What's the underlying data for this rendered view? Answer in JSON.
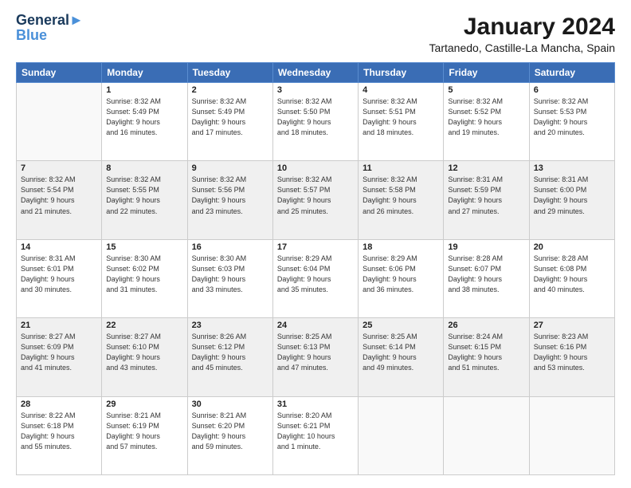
{
  "header": {
    "logo_line1": "General",
    "logo_line2": "Blue",
    "month": "January 2024",
    "location": "Tartanedo, Castille-La Mancha, Spain"
  },
  "weekdays": [
    "Sunday",
    "Monday",
    "Tuesday",
    "Wednesday",
    "Thursday",
    "Friday",
    "Saturday"
  ],
  "weeks": [
    [
      {
        "day": "",
        "info": ""
      },
      {
        "day": "1",
        "info": "Sunrise: 8:32 AM\nSunset: 5:49 PM\nDaylight: 9 hours\nand 16 minutes."
      },
      {
        "day": "2",
        "info": "Sunrise: 8:32 AM\nSunset: 5:49 PM\nDaylight: 9 hours\nand 17 minutes."
      },
      {
        "day": "3",
        "info": "Sunrise: 8:32 AM\nSunset: 5:50 PM\nDaylight: 9 hours\nand 18 minutes."
      },
      {
        "day": "4",
        "info": "Sunrise: 8:32 AM\nSunset: 5:51 PM\nDaylight: 9 hours\nand 18 minutes."
      },
      {
        "day": "5",
        "info": "Sunrise: 8:32 AM\nSunset: 5:52 PM\nDaylight: 9 hours\nand 19 minutes."
      },
      {
        "day": "6",
        "info": "Sunrise: 8:32 AM\nSunset: 5:53 PM\nDaylight: 9 hours\nand 20 minutes."
      }
    ],
    [
      {
        "day": "7",
        "info": "Sunrise: 8:32 AM\nSunset: 5:54 PM\nDaylight: 9 hours\nand 21 minutes."
      },
      {
        "day": "8",
        "info": "Sunrise: 8:32 AM\nSunset: 5:55 PM\nDaylight: 9 hours\nand 22 minutes."
      },
      {
        "day": "9",
        "info": "Sunrise: 8:32 AM\nSunset: 5:56 PM\nDaylight: 9 hours\nand 23 minutes."
      },
      {
        "day": "10",
        "info": "Sunrise: 8:32 AM\nSunset: 5:57 PM\nDaylight: 9 hours\nand 25 minutes."
      },
      {
        "day": "11",
        "info": "Sunrise: 8:32 AM\nSunset: 5:58 PM\nDaylight: 9 hours\nand 26 minutes."
      },
      {
        "day": "12",
        "info": "Sunrise: 8:31 AM\nSunset: 5:59 PM\nDaylight: 9 hours\nand 27 minutes."
      },
      {
        "day": "13",
        "info": "Sunrise: 8:31 AM\nSunset: 6:00 PM\nDaylight: 9 hours\nand 29 minutes."
      }
    ],
    [
      {
        "day": "14",
        "info": "Sunrise: 8:31 AM\nSunset: 6:01 PM\nDaylight: 9 hours\nand 30 minutes."
      },
      {
        "day": "15",
        "info": "Sunrise: 8:30 AM\nSunset: 6:02 PM\nDaylight: 9 hours\nand 31 minutes."
      },
      {
        "day": "16",
        "info": "Sunrise: 8:30 AM\nSunset: 6:03 PM\nDaylight: 9 hours\nand 33 minutes."
      },
      {
        "day": "17",
        "info": "Sunrise: 8:29 AM\nSunset: 6:04 PM\nDaylight: 9 hours\nand 35 minutes."
      },
      {
        "day": "18",
        "info": "Sunrise: 8:29 AM\nSunset: 6:06 PM\nDaylight: 9 hours\nand 36 minutes."
      },
      {
        "day": "19",
        "info": "Sunrise: 8:28 AM\nSunset: 6:07 PM\nDaylight: 9 hours\nand 38 minutes."
      },
      {
        "day": "20",
        "info": "Sunrise: 8:28 AM\nSunset: 6:08 PM\nDaylight: 9 hours\nand 40 minutes."
      }
    ],
    [
      {
        "day": "21",
        "info": "Sunrise: 8:27 AM\nSunset: 6:09 PM\nDaylight: 9 hours\nand 41 minutes."
      },
      {
        "day": "22",
        "info": "Sunrise: 8:27 AM\nSunset: 6:10 PM\nDaylight: 9 hours\nand 43 minutes."
      },
      {
        "day": "23",
        "info": "Sunrise: 8:26 AM\nSunset: 6:12 PM\nDaylight: 9 hours\nand 45 minutes."
      },
      {
        "day": "24",
        "info": "Sunrise: 8:25 AM\nSunset: 6:13 PM\nDaylight: 9 hours\nand 47 minutes."
      },
      {
        "day": "25",
        "info": "Sunrise: 8:25 AM\nSunset: 6:14 PM\nDaylight: 9 hours\nand 49 minutes."
      },
      {
        "day": "26",
        "info": "Sunrise: 8:24 AM\nSunset: 6:15 PM\nDaylight: 9 hours\nand 51 minutes."
      },
      {
        "day": "27",
        "info": "Sunrise: 8:23 AM\nSunset: 6:16 PM\nDaylight: 9 hours\nand 53 minutes."
      }
    ],
    [
      {
        "day": "28",
        "info": "Sunrise: 8:22 AM\nSunset: 6:18 PM\nDaylight: 9 hours\nand 55 minutes."
      },
      {
        "day": "29",
        "info": "Sunrise: 8:21 AM\nSunset: 6:19 PM\nDaylight: 9 hours\nand 57 minutes."
      },
      {
        "day": "30",
        "info": "Sunrise: 8:21 AM\nSunset: 6:20 PM\nDaylight: 9 hours\nand 59 minutes."
      },
      {
        "day": "31",
        "info": "Sunrise: 8:20 AM\nSunset: 6:21 PM\nDaylight: 10 hours\nand 1 minute."
      },
      {
        "day": "",
        "info": ""
      },
      {
        "day": "",
        "info": ""
      },
      {
        "day": "",
        "info": ""
      }
    ]
  ]
}
